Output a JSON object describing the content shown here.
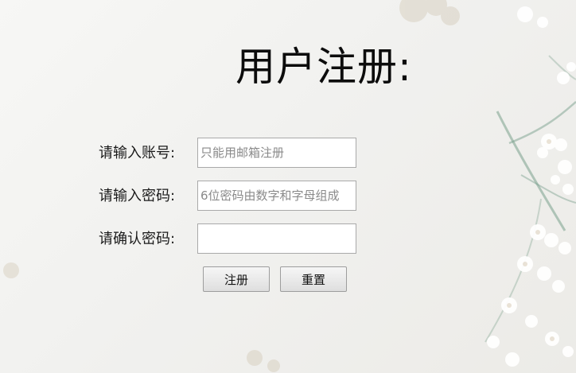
{
  "form": {
    "title": "用户注册:",
    "account": {
      "label": "请输入账号:",
      "placeholder": "只能用邮箱注册",
      "value": ""
    },
    "password": {
      "label": "请输入密码:",
      "placeholder": "6位密码由数字和字母组成",
      "value": ""
    },
    "confirm": {
      "label": "请确认密码:",
      "placeholder": "",
      "value": ""
    },
    "buttons": {
      "register": "注册",
      "reset": "重置"
    }
  },
  "background": {
    "decor_icon": "flower-branch-icon",
    "tint": "#f1f1ef"
  }
}
